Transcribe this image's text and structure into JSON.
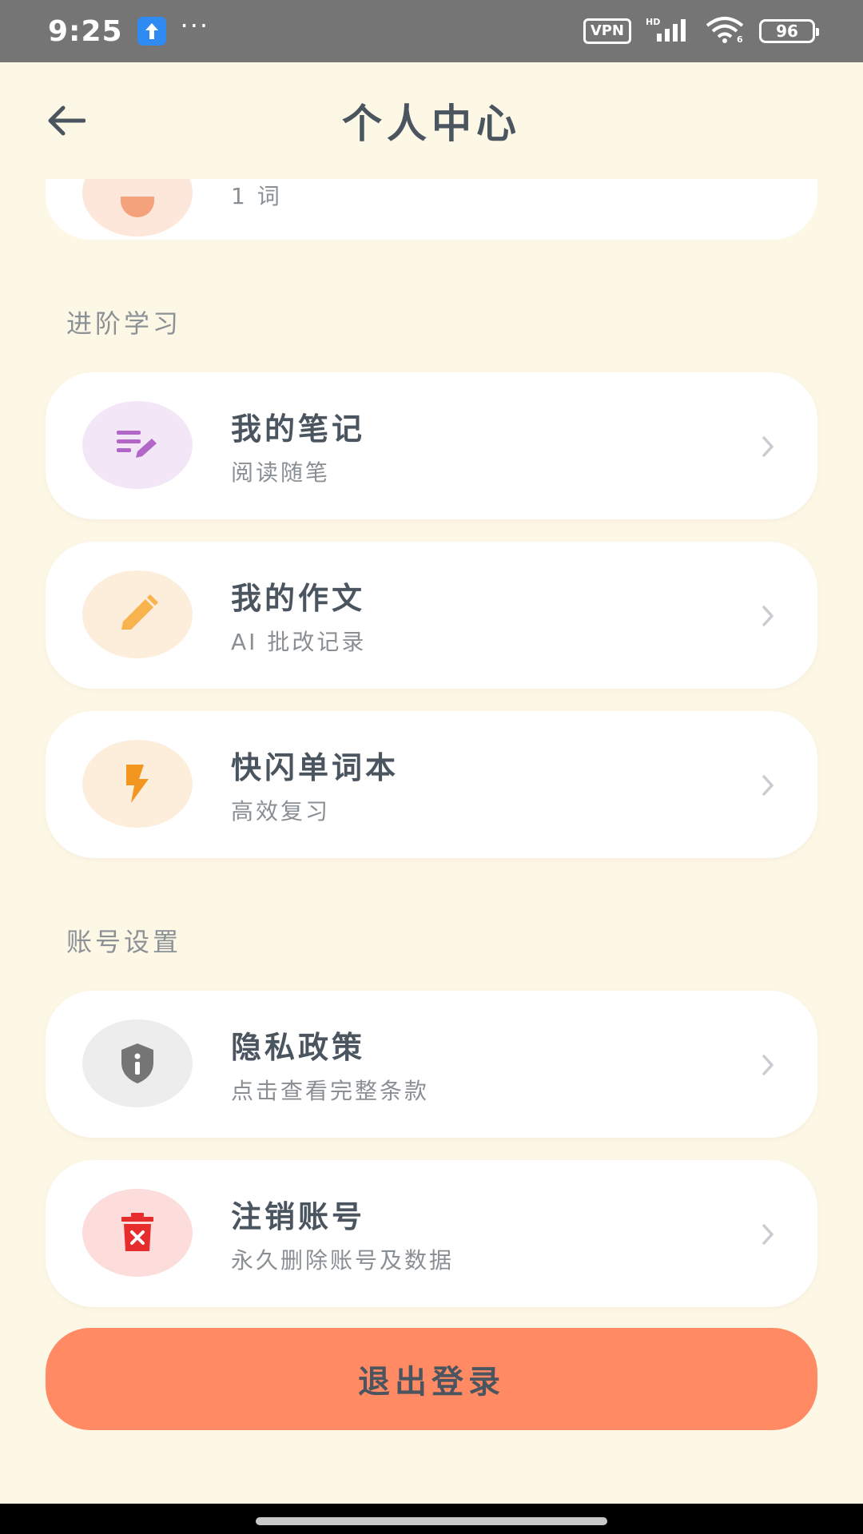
{
  "status_bar": {
    "time": "9:25",
    "dots": "···",
    "vpn": "VPN",
    "battery": "96"
  },
  "header": {
    "title": "个人中心"
  },
  "partial_card": {
    "subtitle": "1 词"
  },
  "sections": {
    "advanced": "进阶学习",
    "account": "账号设置"
  },
  "menu": {
    "notes": {
      "title": "我的笔记",
      "subtitle": "阅读随笔",
      "icon": "note-edit-icon",
      "icon_bg": "#F3E6F7",
      "icon_color": "#B266C8"
    },
    "essays": {
      "title": "我的作文",
      "subtitle": "AI 批改记录",
      "icon": "pencil-icon",
      "icon_bg": "#FDEEDC",
      "icon_color": "#F8B24E"
    },
    "flashcards": {
      "title": "快闪单词本",
      "subtitle": "高效复习",
      "icon": "lightning-icon",
      "icon_bg": "#FDEEDC",
      "icon_color": "#F3961F"
    },
    "privacy": {
      "title": "隐私政策",
      "subtitle": "点击查看完整条款",
      "icon": "shield-info-icon",
      "icon_bg": "#EDEDED",
      "icon_color": "#757575"
    },
    "delete_account": {
      "title": "注销账号",
      "subtitle": "永久删除账号及数据",
      "icon": "delete-icon",
      "icon_bg": "#FDDCDC",
      "icon_color": "#E62C2C"
    }
  },
  "logout": {
    "label": "退出登录",
    "color": "#FF8A63"
  }
}
